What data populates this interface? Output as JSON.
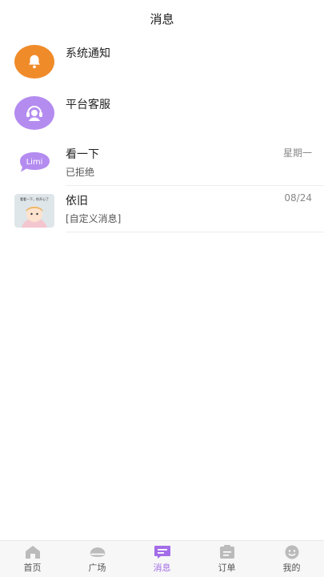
{
  "header": {
    "title": "消息"
  },
  "system_items": [
    {
      "label": "系统通知",
      "icon": "bell-icon",
      "color": "#f08b2a"
    },
    {
      "label": "平台客服",
      "icon": "headset-icon",
      "color": "#b48cf0"
    }
  ],
  "conversations": [
    {
      "name": "看一下",
      "preview": "已拒绝",
      "time": "星期一",
      "avatar_text": "Limi"
    },
    {
      "name": "依旧",
      "preview": "[自定义消息]",
      "time": "08/24",
      "avatar_text": "看看一下，你开心了"
    }
  ],
  "tabbar": {
    "active_color": "#a36ce8",
    "inactive_color": "#bbbbbb",
    "tabs": [
      {
        "label": "首页",
        "icon": "home-icon"
      },
      {
        "label": "广场",
        "icon": "square-icon"
      },
      {
        "label": "消息",
        "icon": "message-icon",
        "active": true
      },
      {
        "label": "订单",
        "icon": "order-icon"
      },
      {
        "label": "我的",
        "icon": "profile-icon"
      }
    ]
  }
}
